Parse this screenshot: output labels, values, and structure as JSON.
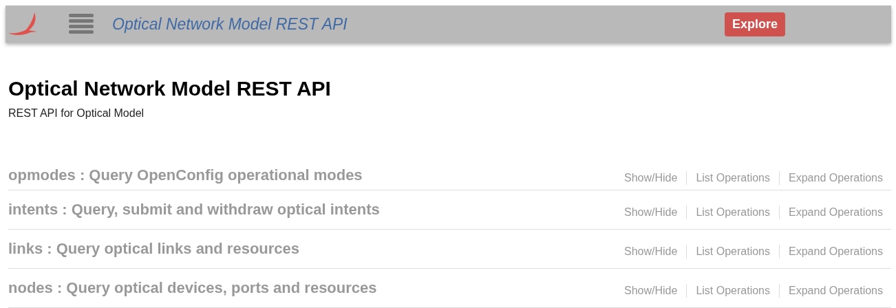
{
  "header": {
    "title": "Optical Network Model REST API",
    "explore_button": "Explore"
  },
  "info": {
    "title": "Optical Network Model REST API",
    "description": "REST API for Optical Model"
  },
  "resources": [
    {
      "name": "opmodes : Query OpenConfig operational modes",
      "actions": [
        "Show/Hide",
        "List Operations",
        "Expand Operations"
      ]
    },
    {
      "name": "intents : Query, submit and withdraw optical intents",
      "actions": [
        "Show/Hide",
        "List Operations",
        "Expand Operations"
      ]
    },
    {
      "name": "links : Query optical links and resources",
      "actions": [
        "Show/Hide",
        "List Operations",
        "Expand Operations"
      ]
    },
    {
      "name": "nodes : Query optical devices, ports and resources",
      "actions": [
        "Show/Hide",
        "List Operations",
        "Expand Operations"
      ]
    }
  ]
}
